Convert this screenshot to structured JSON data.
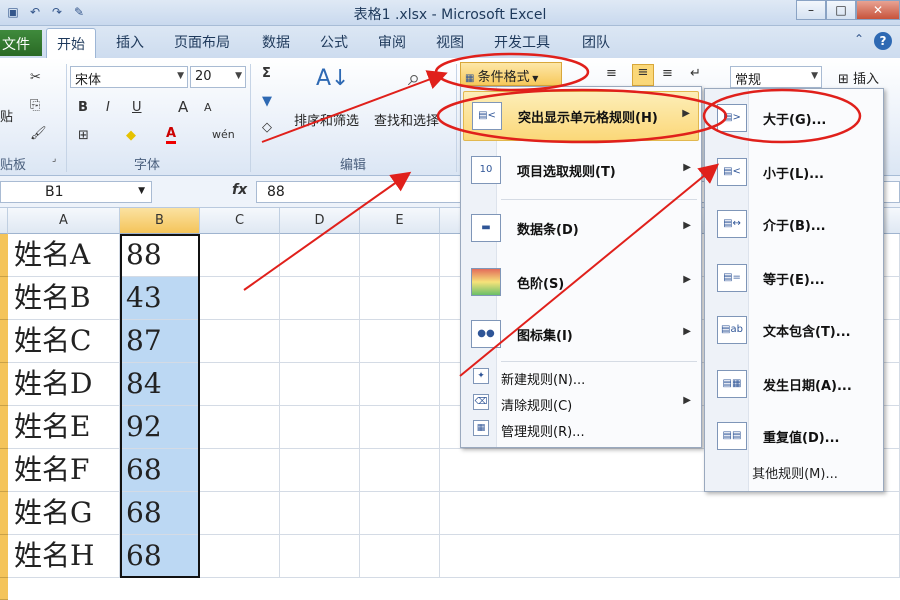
{
  "window": {
    "title": "表格1 .xlsx - Microsoft Excel"
  },
  "qat": {
    "icons": [
      "save-icon",
      "undo-icon",
      "redo-icon",
      "format-painter-icon"
    ]
  },
  "tabs": [
    {
      "label": "文件"
    },
    {
      "label": "开始"
    },
    {
      "label": "插入"
    },
    {
      "label": "页面布局"
    },
    {
      "label": "数据"
    },
    {
      "label": "公式"
    },
    {
      "label": "审阅"
    },
    {
      "label": "视图"
    },
    {
      "label": "开发工具"
    },
    {
      "label": "团队"
    }
  ],
  "ribbon": {
    "paste_label": "贴",
    "clipboard_label": "贴板",
    "font_name": "宋体",
    "font_size": "20",
    "font_group_label": "字体",
    "bold": "B",
    "italic": "I",
    "underline": "U",
    "grow_font": "A",
    "shrink_font": "A",
    "font_color": "A",
    "wen": "wén",
    "sum": "Σ",
    "sort_filter_label": "排序和筛选",
    "find_select_label": "查找和选择",
    "edit_group_label": "编辑",
    "conditional_format_label": "条件格式",
    "number_format": "常规",
    "insert_label": "插入"
  },
  "formula_bar": {
    "name_box": "B1",
    "fx": "fx",
    "value": "88"
  },
  "columns": [
    "A",
    "B",
    "C",
    "D",
    "E"
  ],
  "rows": [
    {
      "name": "姓名A",
      "score": "88"
    },
    {
      "name": "姓名B",
      "score": "43"
    },
    {
      "name": "姓名C",
      "score": "87"
    },
    {
      "name": "姓名D",
      "score": "84"
    },
    {
      "name": "姓名E",
      "score": "92"
    },
    {
      "name": "姓名F",
      "score": "68"
    },
    {
      "name": "姓名G",
      "score": "68"
    },
    {
      "name": "姓名H",
      "score": "68"
    }
  ],
  "cf_menu": {
    "items": [
      {
        "label": "突出显示单元格规则(H)",
        "icon": "highlight-rules-icon"
      },
      {
        "label": "项目选取规则(T)",
        "icon": "top-bottom-rules-icon"
      },
      {
        "label": "数据条(D)",
        "icon": "data-bars-icon"
      },
      {
        "label": "色阶(S)",
        "icon": "color-scales-icon"
      },
      {
        "label": "图标集(I)",
        "icon": "icon-sets-icon"
      }
    ],
    "small_items": [
      {
        "label": "新建规则(N)..."
      },
      {
        "label": "清除规则(C)"
      },
      {
        "label": "管理规则(R)..."
      }
    ]
  },
  "highlight_menu": {
    "items": [
      {
        "label": "大于(G)..."
      },
      {
        "label": "小于(L)..."
      },
      {
        "label": "介于(B)..."
      },
      {
        "label": "等于(E)..."
      },
      {
        "label": "文本包含(T)..."
      },
      {
        "label": "发生日期(A)..."
      },
      {
        "label": "重复值(D)..."
      }
    ],
    "other": "其他规则(M)..."
  },
  "colors": {
    "selection": "#bcd8f3",
    "highlight": "#fbd879",
    "annotation": "#e0201b"
  }
}
